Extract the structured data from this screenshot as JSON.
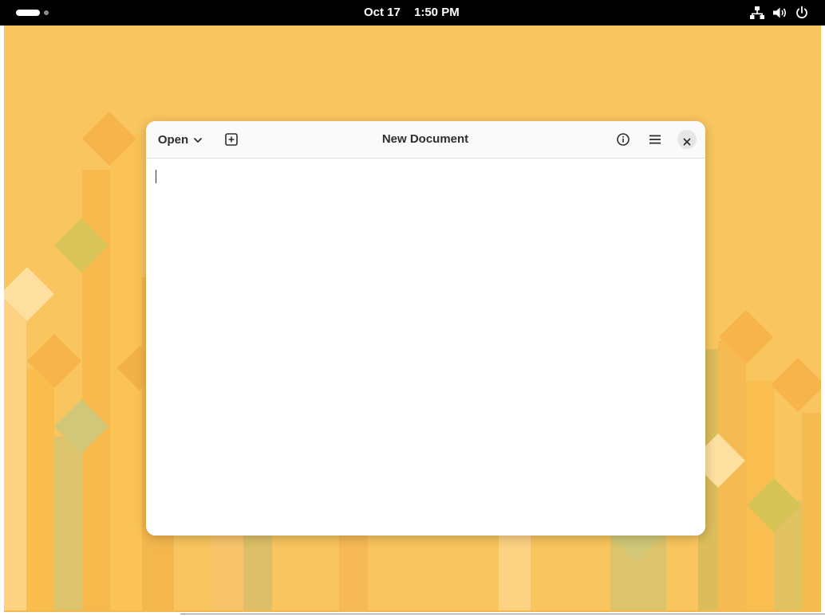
{
  "topbar": {
    "date": "Oct 17",
    "time": "1:50 PM",
    "icons": [
      "network-icon",
      "volume-icon",
      "power-icon"
    ]
  },
  "window": {
    "open_label": "Open",
    "title": "New Document",
    "header_icons": [
      "new-tab-icon",
      "info-icon",
      "menu-icon",
      "close-icon"
    ],
    "editor_text": ""
  },
  "colors": {
    "wallpaper": "#f9c55e",
    "topbar": "#000000",
    "header": "#fafafa",
    "editor": "#ffffff"
  }
}
